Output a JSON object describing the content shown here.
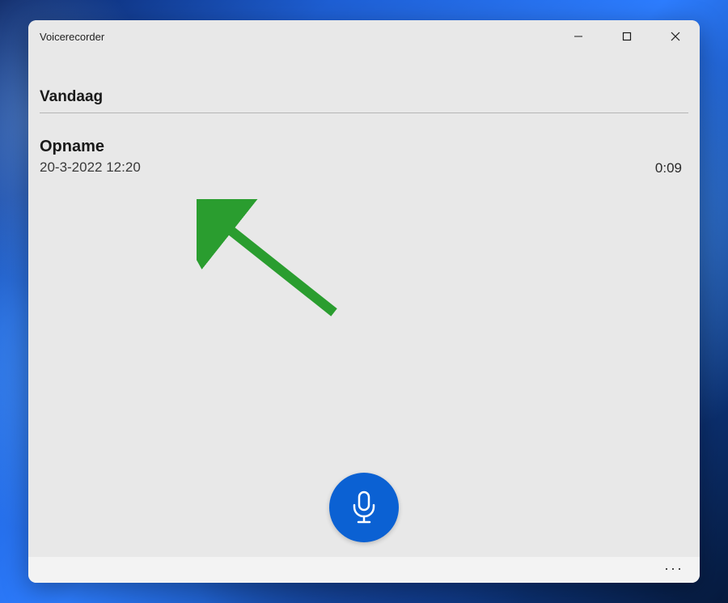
{
  "window": {
    "title": "Voicerecorder"
  },
  "section": {
    "title": "Vandaag"
  },
  "recordings": [
    {
      "title": "Opname",
      "timestamp": "20-3-2022 12:20",
      "duration": "0:09"
    }
  ],
  "colors": {
    "accent": "#0b61d3",
    "annotation": "#2a9d2f"
  },
  "icons": {
    "more": "···"
  }
}
